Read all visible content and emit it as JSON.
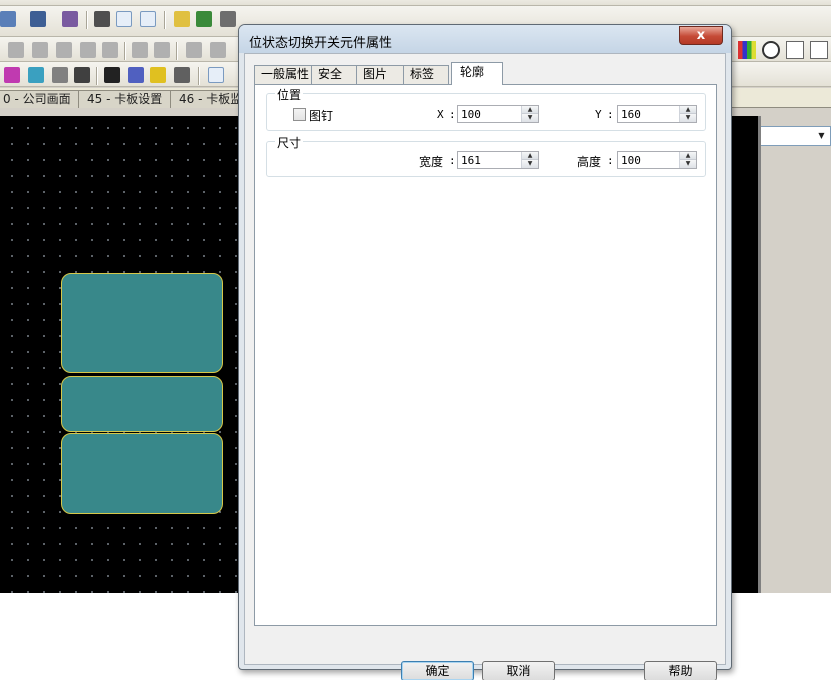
{
  "app": {
    "document_tabs": [
      {
        "label": "0 - 公司画面"
      },
      {
        "label": "45 - 卡板设置"
      },
      {
        "label": "46 - 卡板监"
      }
    ],
    "colors": {
      "canvas": "#000000",
      "switch_fill": "#38888a",
      "switch_border": "#d6c84a"
    }
  },
  "dialog": {
    "title": "位状态切换开关元件属性",
    "close_label": "x",
    "tabs": [
      {
        "label": "一般属性"
      },
      {
        "label": "安全"
      },
      {
        "label": "图片"
      },
      {
        "label": "标签"
      },
      {
        "label": "轮廓",
        "active": true
      }
    ],
    "position": {
      "legend": "位置",
      "pin_label": "图钉",
      "pin_checked": false,
      "x_label": "X",
      "x_value": "100",
      "y_label": "Y",
      "y_value": "160",
      "colon": ":"
    },
    "size": {
      "legend": "尺寸",
      "width_label": "宽度",
      "width_value": "161",
      "height_label": "高度",
      "height_value": "100",
      "colon": ":"
    },
    "buttons": {
      "ok": "确定",
      "cancel": "取消",
      "help": "帮助"
    }
  }
}
